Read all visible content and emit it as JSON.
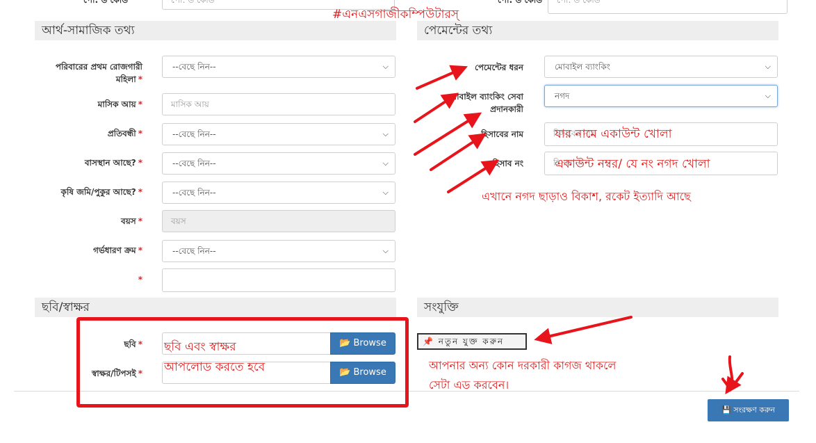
{
  "top_fields": {
    "left_label_partial": "পো: ড কোড",
    "left_placeholder_partial": "পো: ড কোড",
    "right_label_partial": "পো: ড কোড",
    "right_placeholder_partial": "পো: ড কোড"
  },
  "watermark": "#এনএসগাজীকম্পিউটারস্‌",
  "socio_economic": {
    "header": "আর্থ-সামাজিক তথ্য",
    "fields": [
      {
        "label": "পরিবারের প্রথম রোজগারী মহিলা",
        "value": "--বেছে নিন--"
      },
      {
        "label": "মাসিক আয়",
        "value": "মাসিক আয়"
      },
      {
        "label": "প্রতিবন্ধী",
        "value": "--বেছে নিন--"
      },
      {
        "label": "বাসস্থান আছে?",
        "value": "--বেছে নিন--"
      },
      {
        "label": "কৃষি জমি/পুকুর আছে?",
        "value": "--বেছে নিন--"
      },
      {
        "label": "বয়স",
        "value": "বয়স"
      },
      {
        "label": "গর্ভধারণ ক্রম",
        "value": "--বেছে নিন--"
      },
      {
        "label": "",
        "value": ""
      }
    ],
    "required_mark": "*"
  },
  "payment": {
    "header": "পেমেন্টের তথ্য",
    "fields": [
      {
        "label": "পেমেন্টের ধরন",
        "value": "মোবাইল ব্যাংকিং"
      },
      {
        "label": "মোবাইল ব্যাংকিং সেবা প্রদানকারী",
        "value": "নগদ"
      },
      {
        "label": "হিসাবের নাম",
        "value": "হিসাবের নাম"
      },
      {
        "label": "হিসাব নং",
        "value": "হিসাব নং"
      }
    ]
  },
  "photo_signature": {
    "header": "ছবি/স্বাক্ষর",
    "photo_label": "ছবি",
    "signature_label": "স্বাক্ষর/টিপসই",
    "browse_label": "Browse"
  },
  "attachment": {
    "header": "সংযুক্তি",
    "add_new_label": "নতুন যুক্ত করুন"
  },
  "save_button": "সংরক্ষণ করুন",
  "annotations": {
    "account_name_note": "যার নামে একাউন্ট খোলা",
    "account_number_note": "একাউন্ট নম্বর/ যে নং নগদ খোলা",
    "providers_note": "এখানে নগদ ছাড়াও বিকাশ, রকেট ইত্যাদি আছে",
    "upload_note_1": "ছবি এবং স্বাক্ষর",
    "upload_note_2": "আপলোড করতে হবে",
    "attachment_note_1": "আপনার অন্য কোন দরকারী কাগজ থাকলে",
    "attachment_note_2": "সেটা এড করবেন।"
  },
  "colors": {
    "annotation_red": "#e11d1d",
    "primary_blue": "#3a78b5",
    "section_gray": "#eeeeee"
  }
}
